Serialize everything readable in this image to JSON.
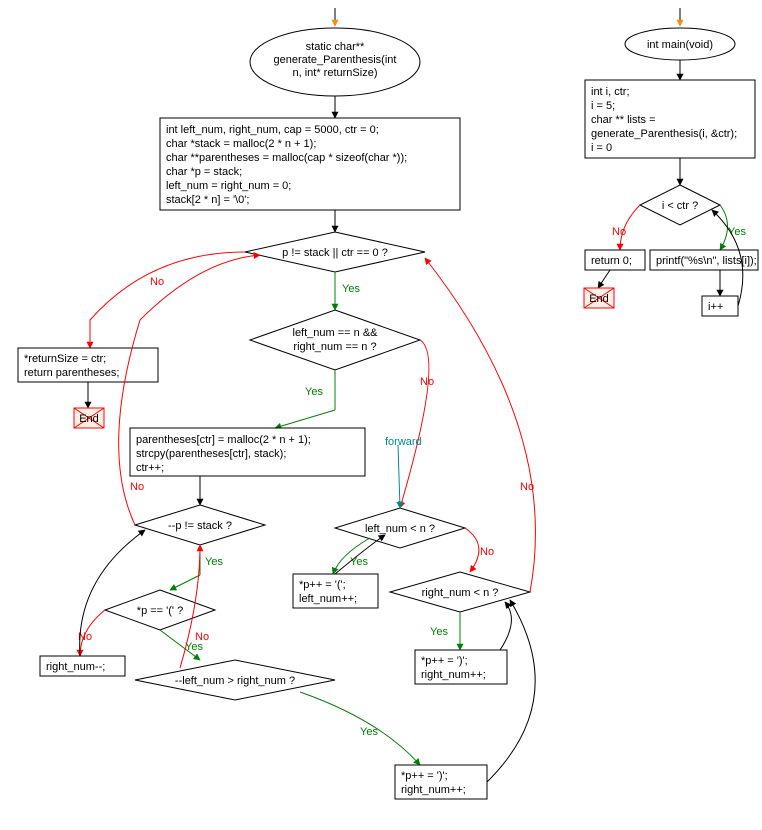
{
  "left": {
    "start_ellipse": "static char**\ngenerate_Parenthesis(int\nn, int* returnSize)",
    "init_box": "int left_num, right_num, cap = 5000, ctr = 0;\nchar *stack = malloc(2 * n + 1);\nchar **parentheses = malloc(cap * sizeof(char *));\nchar *p = stack;\nleft_num = right_num = 0;\nstack[2 * n] = '\\0';",
    "cond_main": "p != stack || ctr == 0 ?",
    "cond_both_n": "left_num == n &&\n right_num == n ?",
    "return_box": "*returnSize = ctr;\nreturn parentheses;",
    "store_box": "parentheses[ctr] = malloc(2 * n + 1);\nstrcpy(parentheses[ctr], stack);\nctr++;",
    "cond_decp": "--p != stack ?",
    "cond_p_open": "*p == '(' ?",
    "right_dec": "right_num--;",
    "cond_dec_left": "--left_num > right_num ?",
    "append_open": "*p++ = '(';\nleft_num++;",
    "cond_left_lt_n": "left_num < n ?",
    "cond_right_lt_n": "right_num < n ?",
    "append_close1": "*p++ = ')';\nright_num++;",
    "append_close2": "*p++ = ')';\nright_num++;",
    "forward_label": "forward",
    "end_label": "End"
  },
  "right": {
    "start_ellipse": "int main(void)",
    "init_box": "int i, ctr;\ni = 5;\nchar ** lists =\ngenerate_Parenthesis(i, &ctr);\ni = 0",
    "cond_loop": "i < ctr ?",
    "return_box": "return 0;",
    "printf_box": "printf(\"%s\\n\", lists[i]);",
    "inc_box": "i++",
    "end_label": "End"
  },
  "labels": {
    "yes": "Yes",
    "no": "No"
  },
  "colors": {
    "yes": "#008000",
    "no": "#ff0000",
    "forward": "#008b8b",
    "end_fill": "#fef0e8",
    "end_stroke": "#ff0000"
  }
}
